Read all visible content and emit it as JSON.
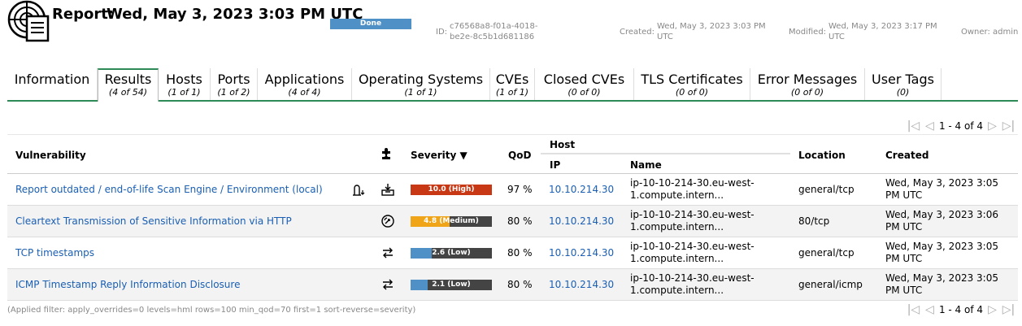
{
  "header": {
    "title_part1": "Report:",
    "title_part2": "Wed, May 3, 2023 3:03 PM UTC",
    "status": "Done",
    "status_color": "#4f91c7",
    "id_label": "ID:",
    "id_value": "c76568a8-f01a-4018-be2e-8c5b1d681186",
    "created_label": "Created:",
    "created_value": "Wed, May 3, 2023 3:03 PM UTC",
    "modified_label": "Modified:",
    "modified_value": "Wed, May 3, 2023 3:17 PM UTC",
    "owner_text": "Owner: admin"
  },
  "tabs": [
    {
      "name": "Information",
      "count": ""
    },
    {
      "name": "Results",
      "count": "(4 of 54)"
    },
    {
      "name": "Hosts",
      "count": "(1 of 1)"
    },
    {
      "name": "Ports",
      "count": "(1 of 2)"
    },
    {
      "name": "Applications",
      "count": "(4 of 4)"
    },
    {
      "name": "Operating Systems",
      "count": "(1 of 1)"
    },
    {
      "name": "CVEs",
      "count": "(1 of 1)"
    },
    {
      "name": "Closed CVEs",
      "count": "(0 of 0)"
    },
    {
      "name": "TLS Certificates",
      "count": "(0 of 0)"
    },
    {
      "name": "Error Messages",
      "count": "(0 of 0)"
    },
    {
      "name": "User Tags",
      "count": "(0)"
    }
  ],
  "active_tab": "Results",
  "pagination": {
    "text": "1 - 4 of 4"
  },
  "table": {
    "headers": {
      "vulnerability": "Vulnerability",
      "severity": "Severity ▼",
      "qod": "QoD",
      "host": "Host",
      "ip": "IP",
      "name": "Name",
      "location": "Location",
      "created": "Created"
    },
    "rows": [
      {
        "vulnerability": "Report outdated / end-of-life Scan Engine / Environment (local)",
        "extra_icon": "vendor-fix-icon",
        "solution_icon": "package-install-icon",
        "severity_value": 10.0,
        "severity_label": "10.0 (High)",
        "severity_color": "#c83814",
        "qod": "97 %",
        "ip": "10.10.214.30",
        "hostname": "ip-10-10-214-30.eu-west-1.compute.intern...",
        "location": "general/tcp",
        "created": "Wed, May 3, 2023 3:05 PM UTC"
      },
      {
        "vulnerability": "Cleartext Transmission of Sensitive Information via HTTP",
        "extra_icon": "",
        "solution_icon": "workaround-icon",
        "severity_value": 4.8,
        "severity_label": "4.8 (Medium)",
        "severity_color": "#f0a519",
        "qod": "80 %",
        "ip": "10.10.214.30",
        "hostname": "ip-10-10-214-30.eu-west-1.compute.intern...",
        "location": "80/tcp",
        "created": "Wed, May 3, 2023 3:06 PM UTC"
      },
      {
        "vulnerability": "TCP timestamps",
        "extra_icon": "",
        "solution_icon": "mitigation-icon",
        "severity_value": 2.6,
        "severity_label": "2.6 (Low)",
        "severity_color": "#4f91c7",
        "qod": "80 %",
        "ip": "10.10.214.30",
        "hostname": "ip-10-10-214-30.eu-west-1.compute.intern...",
        "location": "general/tcp",
        "created": "Wed, May 3, 2023 3:05 PM UTC"
      },
      {
        "vulnerability": "ICMP Timestamp Reply Information Disclosure",
        "extra_icon": "",
        "solution_icon": "mitigation-icon",
        "severity_value": 2.1,
        "severity_label": "2.1 (Low)",
        "severity_color": "#4f91c7",
        "qod": "80 %",
        "ip": "10.10.214.30",
        "hostname": "ip-10-10-214-30.eu-west-1.compute.intern...",
        "location": "general/icmp",
        "created": "Wed, May 3, 2023 3:05 PM UTC"
      }
    ]
  },
  "filter_text": "(Applied filter: apply_overrides=0 levels=hml rows=100 min_qod=70 first=1 sort-reverse=severity)"
}
